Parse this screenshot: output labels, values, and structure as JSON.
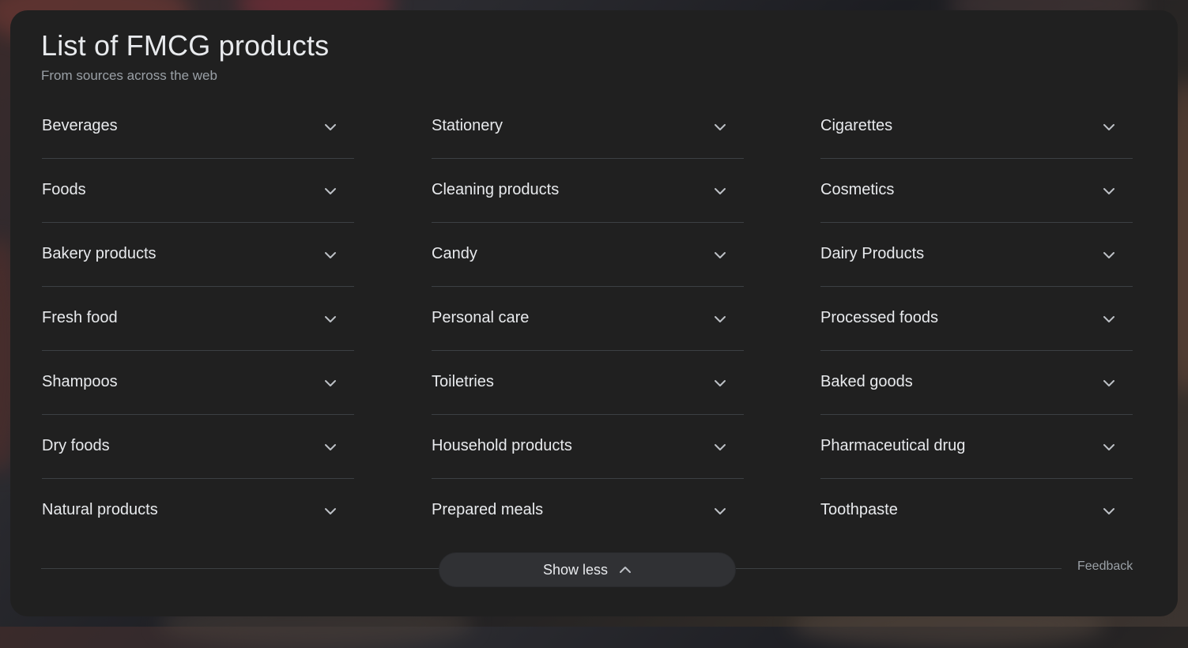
{
  "header": {
    "title": "List of FMCG products",
    "subtitle": "From sources across the web"
  },
  "columns": [
    {
      "items": [
        {
          "label": "Beverages"
        },
        {
          "label": "Foods"
        },
        {
          "label": "Bakery products"
        },
        {
          "label": "Fresh food"
        },
        {
          "label": "Shampoos"
        },
        {
          "label": "Dry foods"
        },
        {
          "label": "Natural products"
        }
      ]
    },
    {
      "items": [
        {
          "label": "Stationery"
        },
        {
          "label": "Cleaning products"
        },
        {
          "label": "Candy"
        },
        {
          "label": "Personal care"
        },
        {
          "label": "Toiletries"
        },
        {
          "label": "Household products"
        },
        {
          "label": "Prepared meals"
        }
      ]
    },
    {
      "items": [
        {
          "label": "Cigarettes"
        },
        {
          "label": "Cosmetics"
        },
        {
          "label": "Dairy Products"
        },
        {
          "label": "Processed foods"
        },
        {
          "label": "Baked goods"
        },
        {
          "label": "Pharmaceutical drug"
        },
        {
          "label": "Toothpaste"
        }
      ]
    }
  ],
  "item_icon": "chevron-down-icon",
  "footer": {
    "show_less_label": "Show less",
    "show_less_icon": "chevron-up-icon",
    "feedback_label": "Feedback"
  },
  "colors": {
    "card_background": "#202020",
    "text_primary": "#e8eaed",
    "text_secondary": "#9aa0a6",
    "divider": "#3c4043",
    "button_background": "#303134"
  }
}
